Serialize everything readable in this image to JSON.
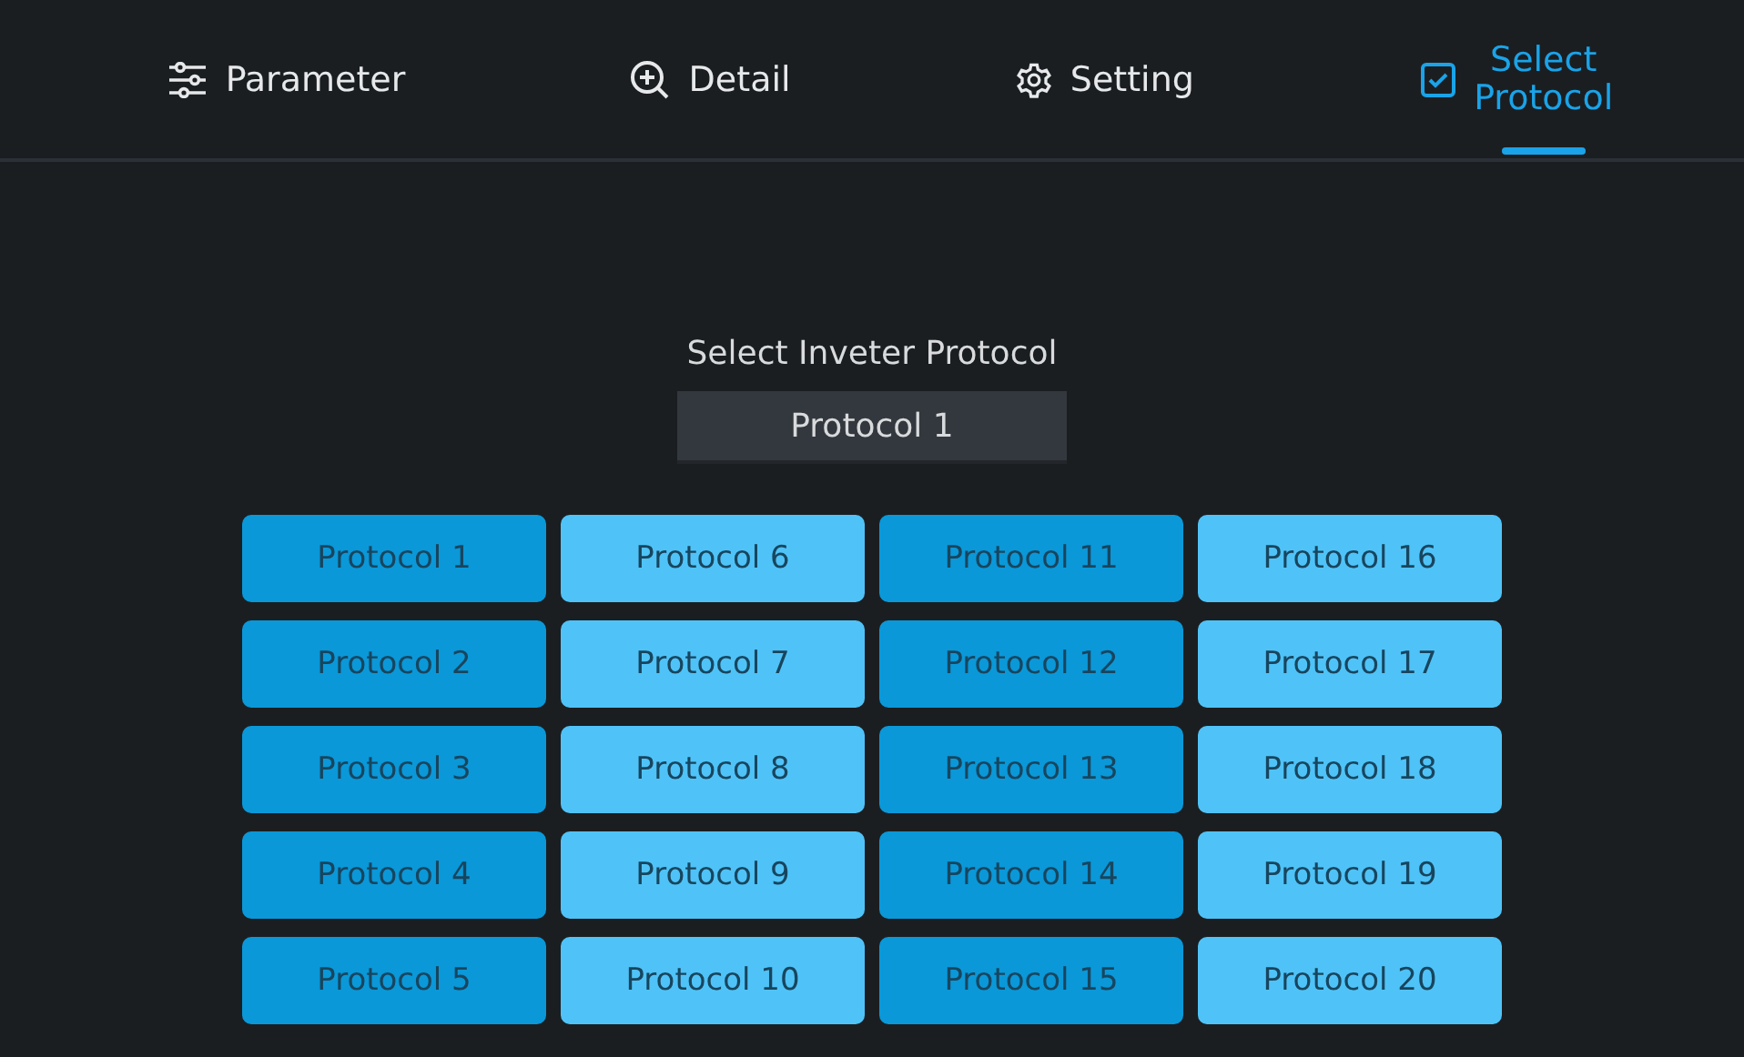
{
  "tabs": [
    {
      "label": "Parameter",
      "kind": "sliders",
      "selected": false
    },
    {
      "label": "Detail",
      "kind": "zoom",
      "selected": false
    },
    {
      "label": "Setting",
      "kind": "gear",
      "selected": false
    },
    {
      "label": "Select\nProtocol",
      "kind": "check",
      "selected": true
    }
  ],
  "title": "Select Inveter Protocol",
  "current_value": "Protocol 1",
  "protocols": [
    {
      "label": "Protocol 1",
      "color": "#0a98d8"
    },
    {
      "label": "Protocol 2",
      "color": "#0a98d8"
    },
    {
      "label": "Protocol 3",
      "color": "#0a98d8"
    },
    {
      "label": "Protocol 4",
      "color": "#0a98d8"
    },
    {
      "label": "Protocol 5",
      "color": "#0a98d8"
    },
    {
      "label": "Protocol 6",
      "color": "#4fc3f7"
    },
    {
      "label": "Protocol 7",
      "color": "#4fc3f7"
    },
    {
      "label": "Protocol 8",
      "color": "#4fc3f7"
    },
    {
      "label": "Protocol 9",
      "color": "#4fc3f7"
    },
    {
      "label": "Protocol 10",
      "color": "#4fc3f7"
    },
    {
      "label": "Protocol 11",
      "color": "#0a98d8"
    },
    {
      "label": "Protocol 12",
      "color": "#0a98d8"
    },
    {
      "label": "Protocol 13",
      "color": "#0a98d8"
    },
    {
      "label": "Protocol 14",
      "color": "#0a98d8"
    },
    {
      "label": "Protocol 15",
      "color": "#0a98d8"
    },
    {
      "label": "Protocol 16",
      "color": "#4fc3f7"
    },
    {
      "label": "Protocol 17",
      "color": "#4fc3f7"
    },
    {
      "label": "Protocol 18",
      "color": "#4fc3f7"
    },
    {
      "label": "Protocol 19",
      "color": "#4fc3f7"
    },
    {
      "label": "Protocol 20",
      "color": "#4fc3f7"
    }
  ]
}
